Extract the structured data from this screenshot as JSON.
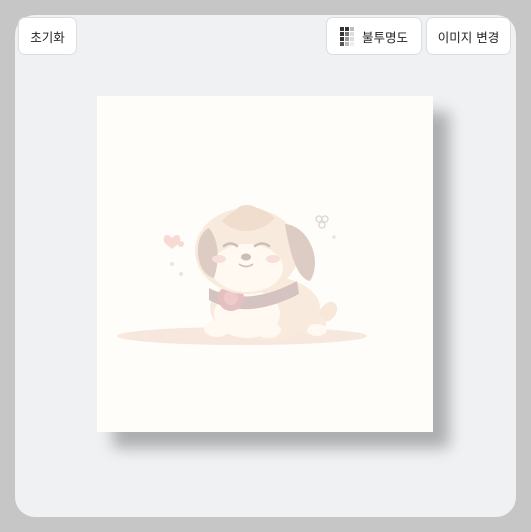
{
  "toolbar": {
    "reset_label": "초기화",
    "opacity_label": "불투명도",
    "opacity_icon": "opacity-grid-icon",
    "change_image_label": "이미지 변경"
  },
  "canvas": {
    "image_subject": "puppy-illustration",
    "opacity": 0.35
  },
  "colors": {
    "outer_background": "#c6c6c6",
    "panel_background": "#f0f1f3",
    "image_background": "#fffdf9"
  }
}
